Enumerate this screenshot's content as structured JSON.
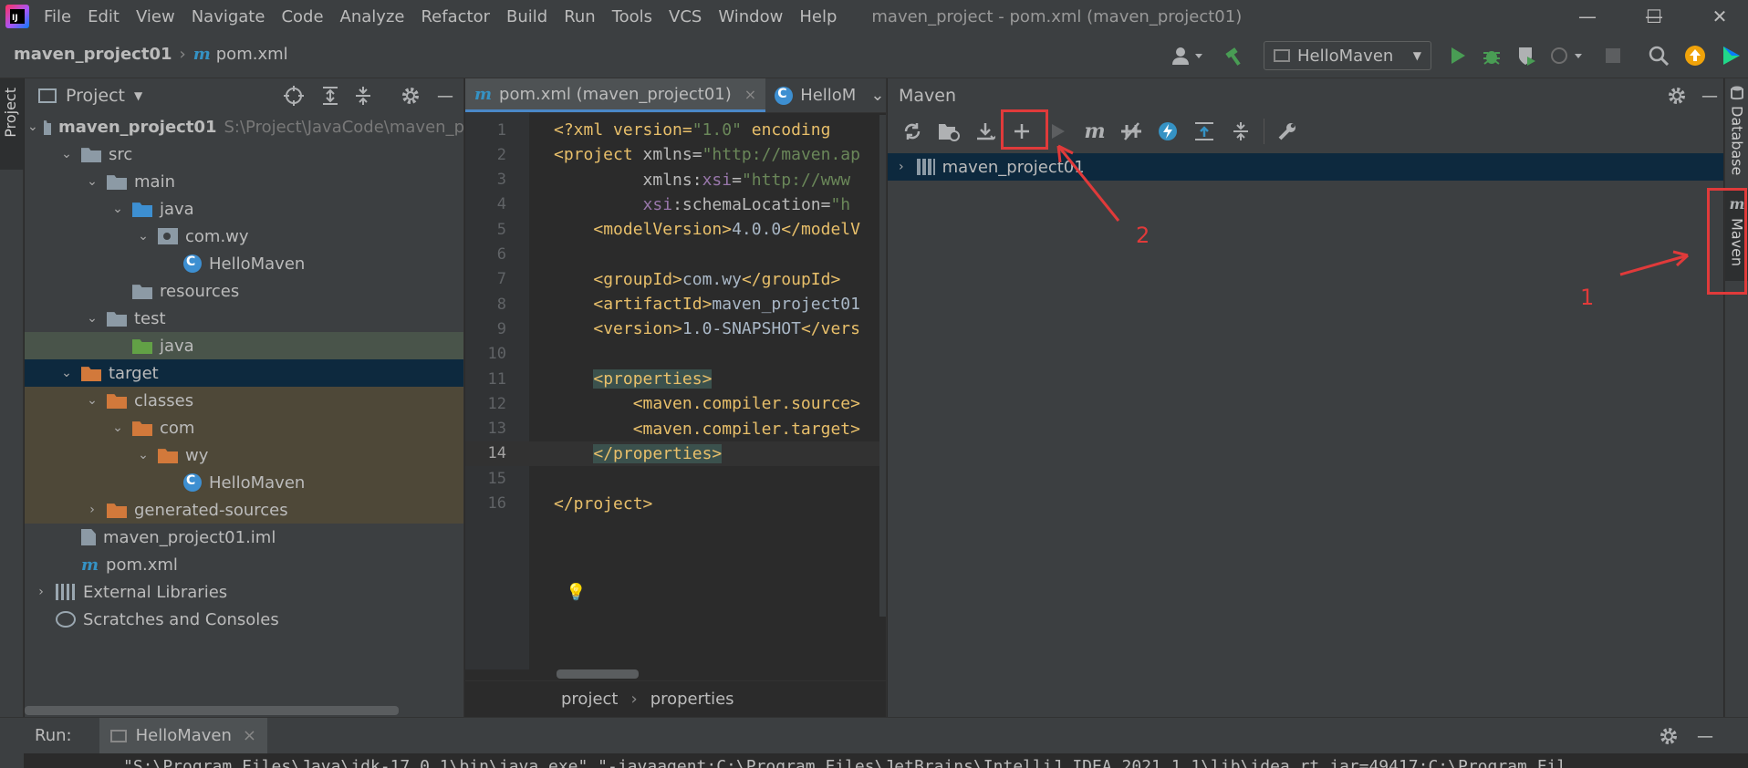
{
  "menubar": {
    "items": [
      "File",
      "Edit",
      "View",
      "Navigate",
      "Code",
      "Analyze",
      "Refactor",
      "Build",
      "Run",
      "Tools",
      "VCS",
      "Window",
      "Help"
    ],
    "window_title": "maven_project - pom.xml (maven_project01)",
    "controls": [
      "—",
      "☐",
      "✕"
    ]
  },
  "navbar": {
    "project": "maven_project01",
    "file_icon": "m",
    "file": "pom.xml",
    "run_config": "HelloMaven",
    "icons": [
      "user-icon",
      "build-hammer-icon",
      "run-icon",
      "debug-icon",
      "coverage-icon",
      "profile-icon",
      "stop-icon",
      "search-icon",
      "update-icon",
      "toolbox-icon"
    ]
  },
  "left_strip": {
    "tab": "Project"
  },
  "project_panel": {
    "title": "Project",
    "tree": [
      {
        "label": "maven_project01",
        "hint": "S:\\Project\\JavaCode\\maven_p",
        "bold": true,
        "level": 0,
        "chev": "⌄",
        "icon": "module"
      },
      {
        "label": "src",
        "level": 1,
        "chev": "⌄",
        "icon": "folder-gray"
      },
      {
        "label": "main",
        "level": 2,
        "chev": "⌄",
        "icon": "folder-gray"
      },
      {
        "label": "java",
        "level": 3,
        "chev": "⌄",
        "icon": "folder-blue"
      },
      {
        "label": "com.wy",
        "level": 4,
        "chev": "⌄",
        "icon": "package"
      },
      {
        "label": "HelloMaven",
        "level": 5,
        "chev": "",
        "icon": "class"
      },
      {
        "label": "resources",
        "level": 3,
        "chev": "",
        "icon": "folder-gray"
      },
      {
        "label": "test",
        "level": 2,
        "chev": "⌄",
        "icon": "folder-gray"
      },
      {
        "label": "java",
        "level": 3,
        "chev": "",
        "icon": "folder-green",
        "row": "test"
      },
      {
        "label": "target",
        "level": 1,
        "chev": "⌄",
        "icon": "folder-orange",
        "row": "sel"
      },
      {
        "label": "classes",
        "level": 2,
        "chev": "⌄",
        "icon": "folder-orange",
        "row": "excl"
      },
      {
        "label": "com",
        "level": 3,
        "chev": "⌄",
        "icon": "folder-orange",
        "row": "excl"
      },
      {
        "label": "wy",
        "level": 4,
        "chev": "⌄",
        "icon": "folder-orange",
        "row": "excl"
      },
      {
        "label": "HelloMaven",
        "level": 5,
        "chev": "",
        "icon": "class",
        "row": "excl"
      },
      {
        "label": "generated-sources",
        "level": 2,
        "chev": "›",
        "icon": "folder-orange",
        "row": "excl"
      },
      {
        "label": "maven_project01.iml",
        "level": 1,
        "chev": "",
        "icon": "file"
      },
      {
        "label": "pom.xml",
        "level": 1,
        "chev": "",
        "icon": "maven"
      },
      {
        "label": "External Libraries",
        "level": 0,
        "chev": "›",
        "icon": "library"
      },
      {
        "label": "Scratches and Consoles",
        "level": 0,
        "chev": "",
        "icon": "scratch"
      }
    ]
  },
  "editor": {
    "tabs": [
      {
        "label": "pom.xml (maven_project01)",
        "active": true,
        "close": "×"
      },
      {
        "label": "HelloM",
        "active": false
      }
    ],
    "more": "⌄",
    "current_line": 14,
    "lines": [
      {
        "n": "1",
        "html": "<span class=\"t-pi\">&lt;?xml version=</span><span class=\"t-str\">\"1.0\"</span><span class=\"t-pi\"> encoding</span>"
      },
      {
        "n": "2",
        "html": "<span class=\"t-tag\">&lt;project</span> <span class=\"t-attr\">xmlns=</span><span class=\"t-str\">\"http://maven.ap</span>"
      },
      {
        "n": "3",
        "html": "         <span class=\"t-attr\">xmlns:</span><span class=\"t-ns\">xsi</span><span class=\"t-attr\">=</span><span class=\"t-str\">\"http://www</span>"
      },
      {
        "n": "4",
        "html": "         <span class=\"t-ns\">xsi</span><span class=\"t-attr\">:schemaLocation=</span><span class=\"t-str\">\"h</span>"
      },
      {
        "n": "5",
        "html": "    <span class=\"t-tag\">&lt;modelVersion&gt;</span><span class=\"t-text\">4.0.0</span><span class=\"t-tag\">&lt;/modelV</span>"
      },
      {
        "n": "6",
        "html": ""
      },
      {
        "n": "7",
        "html": "    <span class=\"t-tag\">&lt;groupId&gt;</span><span class=\"t-text\">com.wy</span><span class=\"t-tag\">&lt;/groupId&gt;</span>"
      },
      {
        "n": "8",
        "html": "    <span class=\"t-tag\">&lt;artifactId&gt;</span><span class=\"t-text\">maven_project01</span>"
      },
      {
        "n": "9",
        "html": "    <span class=\"t-tag\">&lt;version&gt;</span><span class=\"t-text\">1.0-SNAPSHOT</span><span class=\"t-tag\">&lt;/vers</span>"
      },
      {
        "n": "10",
        "html": ""
      },
      {
        "n": "11",
        "html": "    <span class=\"t-tag t-hl\">&lt;properties&gt;</span>"
      },
      {
        "n": "12",
        "html": "        <span class=\"t-tag\">&lt;maven.compiler.source&gt;</span>"
      },
      {
        "n": "13",
        "html": "        <span class=\"t-tag\">&lt;maven.compiler.target&gt;</span>"
      },
      {
        "n": "14",
        "html": "    <span class=\"t-tag t-hl\">&lt;/properties&gt;</span>"
      },
      {
        "n": "15",
        "html": ""
      },
      {
        "n": "16",
        "html": "<span class=\"t-tag\">&lt;/project&gt;</span>"
      }
    ],
    "breadcrumb": [
      "project",
      "properties"
    ]
  },
  "maven_panel": {
    "title": "Maven",
    "root": "maven_project01"
  },
  "right_strip": {
    "tabs": [
      "Database",
      "Maven"
    ]
  },
  "annotations": {
    "label_1": "1",
    "label_2": "2"
  },
  "run_panel": {
    "label": "Run:",
    "tab": "HelloMaven",
    "close": "×",
    "console_line": "\"S:\\Program Files\\Java\\jdk-17.0.1\\bin\\java.exe\" \"-javaagent:C:\\Program Files\\JetBrains\\IntelliJ IDEA 2021.1.1\\lib\\idea_rt.jar=49417:C:\\Program Fil"
  },
  "colors": {
    "accent": "#4a88c7",
    "annotation_red": "#e03a3a",
    "selection": "#0d293e"
  }
}
